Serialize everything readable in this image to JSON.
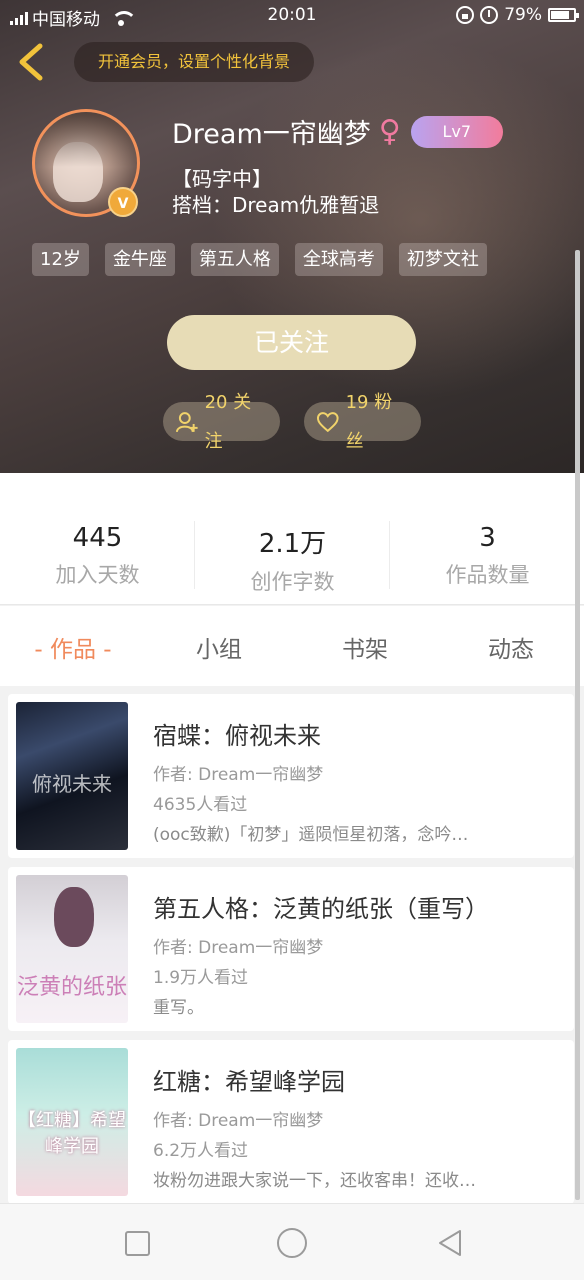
{
  "status_bar": {
    "carrier": "中国移动",
    "time": "20:01",
    "battery": "79%"
  },
  "header": {
    "vip_banner": "开通会员，设置个性化背景"
  },
  "profile": {
    "name": "Dream一帘幽梦",
    "gender_icon": "female-icon",
    "level": "Lv7",
    "verified_badge": "V",
    "status": "【码字中】",
    "partner": "搭档：Dream仇雅暂退",
    "tags": [
      "12岁",
      "金牛座",
      "第五人格",
      "全球高考",
      "初梦文社"
    ],
    "follow_button": "已关注",
    "following_label": "20 关注",
    "fans_label": "19 粉丝"
  },
  "counts": [
    {
      "value": "445",
      "label": "加入天数"
    },
    {
      "value": "2.1万",
      "label": "创作字数"
    },
    {
      "value": "3",
      "label": "作品数量"
    }
  ],
  "tabs": [
    "- 作品 -",
    "小组",
    "书架",
    "动态"
  ],
  "works": [
    {
      "cover_text": "俯视未来",
      "title": "宿蝶：俯视未来",
      "author": "作者: Dream一帘幽梦",
      "views": "4635人看过",
      "desc": "(ooc致歉)「初梦」遥陨恒星初落，念吟…"
    },
    {
      "cover_text": "泛黄的纸张",
      "title": "第五人格：泛黄的纸张（重写）",
      "author": "作者: Dream一帘幽梦",
      "views": "1.9万人看过",
      "desc": "重写。"
    },
    {
      "cover_text": "【红糖】希望峰学园",
      "title": "红糖：希望峰学园",
      "author": "作者: Dream一帘幽梦",
      "views": "6.2万人看过",
      "desc": "妆粉勿进跟大家说一下，还收客串！还收客串…"
    }
  ],
  "colors": {
    "accent": "#f08a5c",
    "gold": "#f2c33b",
    "follow_button_bg": "#e7dcb6"
  }
}
